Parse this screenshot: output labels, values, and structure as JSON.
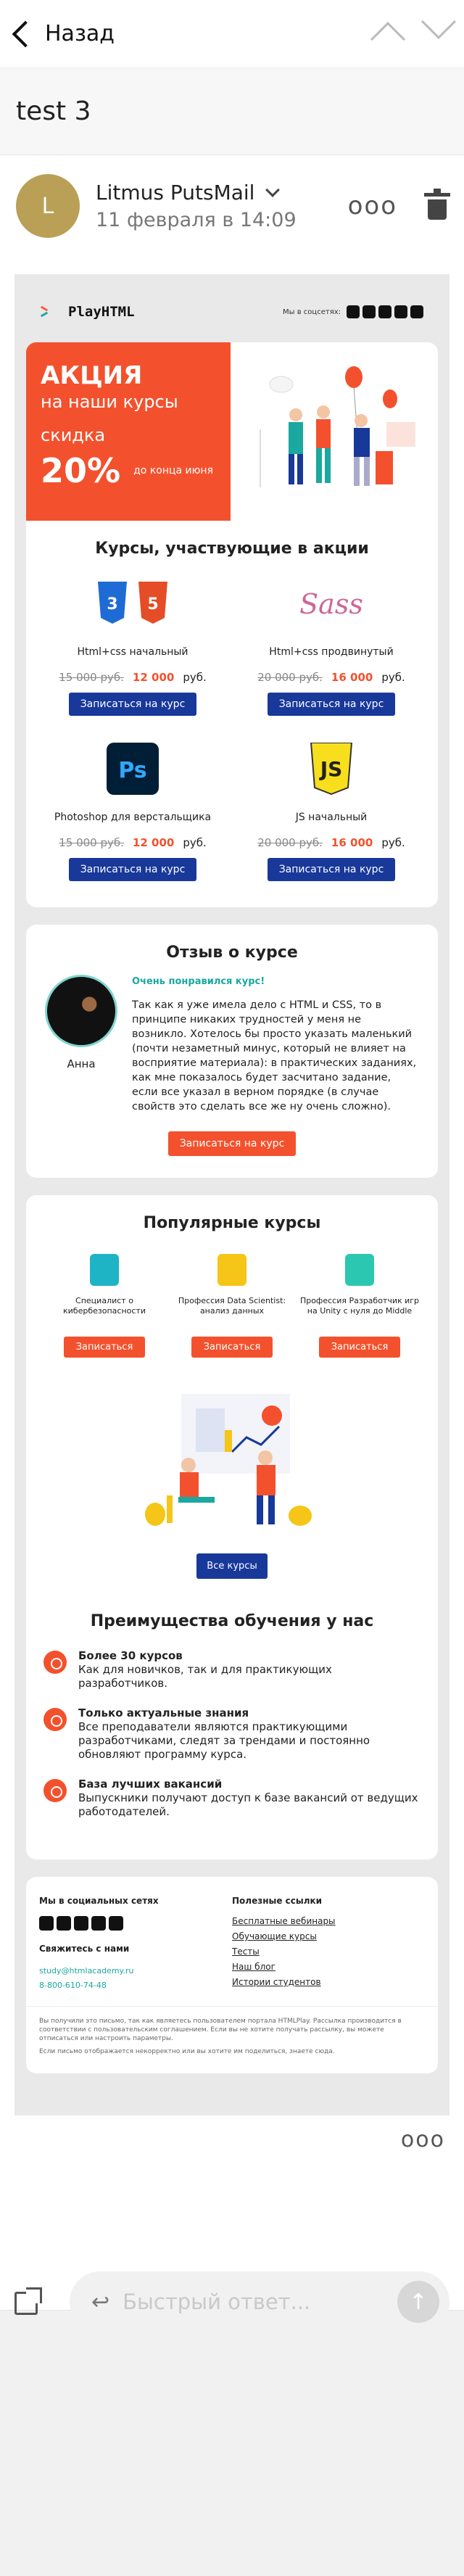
{
  "topbar": {
    "back_label": "Назад"
  },
  "subject": "test 3",
  "sender": {
    "initial": "L",
    "name": "Litmus PutsMail",
    "date": "11 февраля в 14:09",
    "more": "ooo"
  },
  "email": {
    "brand": "PlayHTML",
    "social_label": "Мы в соцсетях:",
    "promo": {
      "title": "АКЦИЯ",
      "subtitle": "на наши курсы",
      "discount_label": "скидка",
      "percent": "20%",
      "until": "до конца июня"
    },
    "courses_title": "Курсы, участвующие в акции",
    "courses": [
      {
        "name": "Html+css начальный",
        "old": "15 000 руб.",
        "new": "12 000",
        "cur": "руб.",
        "button": "Записаться на курс",
        "icon": "html-css-icon"
      },
      {
        "name": "Html+css продвинутый",
        "old": "20 000 руб.",
        "new": "16 000",
        "cur": "руб.",
        "button": "Записаться на курс",
        "icon": "sass-icon"
      },
      {
        "name": "Photoshop для верстальщика",
        "old": "15 000 руб.",
        "new": "12 000",
        "cur": "руб.",
        "button": "Записаться на курс",
        "icon": "photoshop-icon"
      },
      {
        "name": "JS начальный",
        "old": "20 000 руб.",
        "new": "16 000",
        "cur": "руб.",
        "button": "Записаться на курс",
        "icon": "js-icon"
      }
    ],
    "review": {
      "title": "Отзыв о курсе",
      "author": "Анна",
      "highlight": "Очень понравился курс!",
      "text": "Так как я уже имела дело с HTML и CSS, то в принципе никаких трудностей у меня не возникло. Хотелось бы просто указать маленький (почти незаметный минус, который не влияет на восприятие материала): в практических заданиях, как мне показалось будет засчитано задание, если все указал в верном порядке (в случае свойств это сделать все же ну очень сложно).",
      "button": "Записаться на курс"
    },
    "popular": {
      "title": "Популярные курсы",
      "items": [
        {
          "title": "Специалист о кибербезопасности",
          "button": "Записаться",
          "color": "#1fb3c6"
        },
        {
          "title": "Профессия Data Scientist: анализ данных",
          "button": "Записаться",
          "color": "#f5c518"
        },
        {
          "title": "Профессия Разработчик игр на Unity с нуля до Middle",
          "button": "Записаться",
          "color": "#2cc7b0"
        }
      ],
      "all_button": "Все курсы"
    },
    "advantages": {
      "title": "Преимущества обучения у нас",
      "items": [
        {
          "head": "Более 30 курсов",
          "text": "Как для новичков, так и для практикующих разработчиков."
        },
        {
          "head": "Только актуальные знания",
          "text": "Все преподаватели являются практикующими разработчиками, следят за трендами и постоянно обновляют программу курса."
        },
        {
          "head": "База лучших вакансий",
          "text": "Выпускники получают доступ к базе вакансий от ведущих работодателей."
        }
      ]
    },
    "footer": {
      "social_title": "Мы в социальных сетях",
      "contact_title": "Свяжитесь с нами",
      "email": "study@htmlacademy.ru",
      "phone": "8-800-610-74-48",
      "links_title": "Полезные ссылки",
      "links": [
        "Бесплатные вебинары",
        "Обучающие курсы",
        "Тесты",
        "Наш блог",
        "Истории студентов"
      ],
      "legal1": "Вы получили это письмо, так как являетесь пользователем портала HTMLPlay. Рассылка производится в соответствии с пользовательским соглашением. Если вы не хотите получать рассылку, вы можете отписаться или настроить параметры.",
      "legal2": "Если письмо отображается некорректно или вы хотите им поделиться, знаете сюда."
    }
  },
  "more_label": "ooo",
  "reply": {
    "placeholder": "Быстрый ответ..."
  },
  "colors": {
    "accent": "#f3512d",
    "primary": "#18389a",
    "teal": "#1aa8a0"
  }
}
